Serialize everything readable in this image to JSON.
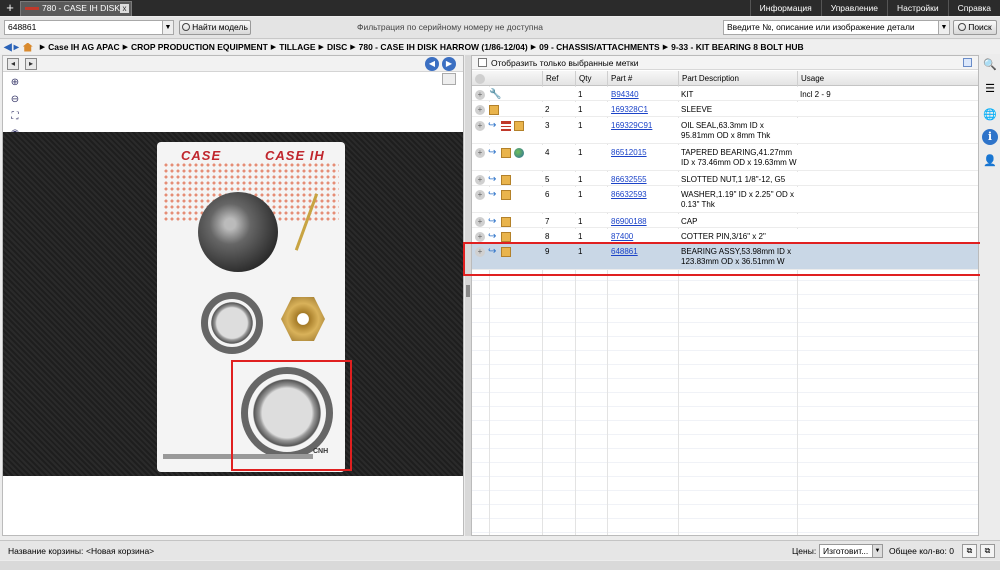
{
  "app": {
    "tab_title": "780 - CASE IH DISK...",
    "tab_close": "x",
    "new_tab": "+",
    "menu": [
      "Информация",
      "Управление",
      "Настройки",
      "Справка"
    ]
  },
  "search": {
    "serial_value": "648861",
    "find_model_label": "Найти модель",
    "serial_filter_note": "Фильтрация по серийному номеру не доступна",
    "part_search_placeholder": "Введите №, описание или изображение детали",
    "search_label": "Поиск"
  },
  "breadcrumb": [
    "Case IH AG APAC",
    "CROP PRODUCTION EQUIPMENT",
    "TILLAGE",
    "DISC",
    "780 - CASE IH DISK HARROW (1/86-12/04)",
    "09 - CHASSIS/ATTACHMENTS",
    "9-33 - KIT BEARING 8 BOLT HUB"
  ],
  "image_pane": {
    "logo_text": "CASE",
    "logo_text_ih": "CASE IH",
    "brand_mark": "CNH",
    "tools": [
      "zoom-in-icon",
      "zoom-out-icon",
      "fit-icon",
      "magnifier-icon",
      "print-icon",
      "email-icon"
    ]
  },
  "parts_pane": {
    "filter_label": "Отобразить только выбранные метки",
    "columns": {
      "ref": "Ref",
      "qty": "Qty",
      "part": "Part #",
      "desc": "Part Description",
      "usage": "Usage"
    },
    "rows": [
      {
        "ref": "",
        "qty": "1",
        "part": "B94340",
        "desc": "KIT",
        "usage": "Incl 2 - 9",
        "icons": [
          "wrench"
        ]
      },
      {
        "ref": "2",
        "qty": "1",
        "part": "169328C1",
        "desc": "SLEEVE",
        "usage": "",
        "icons": [
          "box"
        ]
      },
      {
        "ref": "3",
        "qty": "1",
        "part": "169329C91",
        "desc": "OIL SEAL,63.3mm ID x 95.81mm OD x 8mm Thk",
        "usage": "",
        "icons": [
          "arrow",
          "doc",
          "box"
        ]
      },
      {
        "ref": "4",
        "qty": "1",
        "part": "86512015",
        "desc": "TAPERED BEARING,41.27mm ID x 73.46mm OD x 19.63mm W",
        "usage": "",
        "icons": [
          "arrow",
          "box",
          "globe"
        ]
      },
      {
        "ref": "5",
        "qty": "1",
        "part": "86632555",
        "desc": "SLOTTED NUT,1 1/8\"-12, G5",
        "usage": "",
        "icons": [
          "arrow",
          "box"
        ]
      },
      {
        "ref": "6",
        "qty": "1",
        "part": "86632593",
        "desc": "WASHER,1.19\" ID x 2.25\" OD x 0.13\" Thk",
        "usage": "",
        "icons": [
          "arrow",
          "box"
        ]
      },
      {
        "ref": "7",
        "qty": "1",
        "part": "86900188",
        "desc": "CAP",
        "usage": "",
        "icons": [
          "arrow",
          "box"
        ]
      },
      {
        "ref": "8",
        "qty": "1",
        "part": "87400",
        "desc": "COTTER PIN,3/16\" x 2\"",
        "usage": "",
        "icons": [
          "arrow",
          "box"
        ]
      },
      {
        "ref": "9",
        "qty": "1",
        "part": "648861",
        "desc": "BEARING ASSY,53.98mm ID x 123.83mm OD x 36.51mm W",
        "usage": "",
        "icons": [
          "arrow",
          "box"
        ],
        "selected": true
      }
    ]
  },
  "status": {
    "cart_label": "Название корзины:",
    "cart_value": "<Новая корзина>",
    "prices_label": "Цены:",
    "prices_value": "Изготовит...",
    "total_label": "Общее кол-во: 0"
  },
  "colors": {
    "accent": "#2e73c9",
    "highlight": "#e02020",
    "selected_row": "#c9d7e6",
    "brand": "#c0262d"
  }
}
